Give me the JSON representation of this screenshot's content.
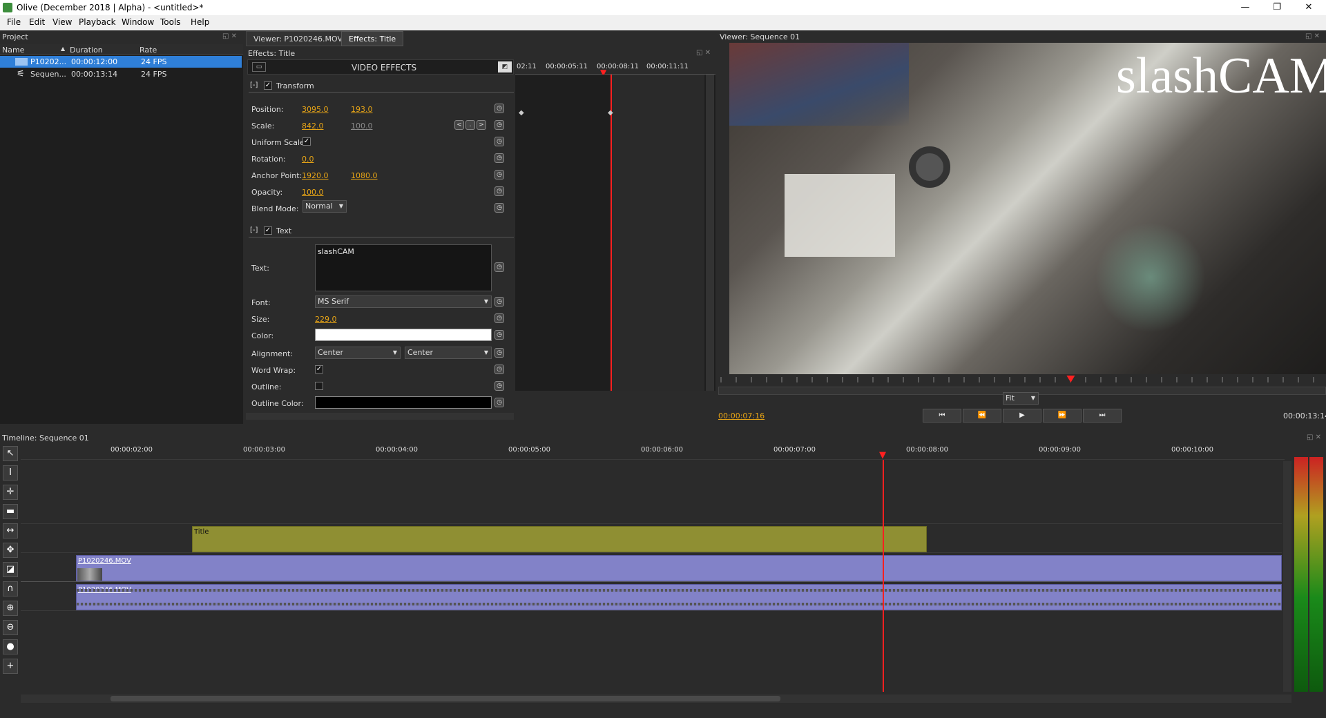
{
  "window": {
    "title": "Olive (December 2018 | Alpha) - <untitled>*",
    "minimize": "—",
    "maximize": "❐",
    "close": "✕"
  },
  "menu": [
    "File",
    "Edit",
    "View",
    "Playback",
    "Window",
    "Tools",
    "Help"
  ],
  "project": {
    "title": "Project",
    "columns": [
      "Name",
      "Duration",
      "Rate"
    ],
    "rows": [
      {
        "name": "P10202...",
        "duration": "00:00:12:00",
        "rate": "24 FPS"
      },
      {
        "name": "Sequen...",
        "duration": "00:00:13:14",
        "rate": "24 FPS"
      }
    ]
  },
  "center_tabs": [
    "Viewer: P1020246.MOV",
    "Effects: Title"
  ],
  "effects": {
    "title": "Effects: Title",
    "header": "VIDEO EFFECTS",
    "timecodes": [
      "02:11",
      "00:00:05:11",
      "00:00:08:11",
      "00:00:11:11"
    ],
    "transform": {
      "label": "Transform",
      "expander": "[-]",
      "position_label": "Position:",
      "position_x": "3095.0",
      "position_y": "193.0",
      "scale_label": "Scale:",
      "scale_x": "842.0",
      "scale_y": "100.0",
      "nav_prev": "<",
      "nav_mid": ".",
      "nav_next": ">",
      "uniform_label": "Uniform Scale:",
      "rotation_label": "Rotation:",
      "rotation": "0.0",
      "anchor_label": "Anchor Point:",
      "anchor_x": "1920.0",
      "anchor_y": "1080.0",
      "opacity_label": "Opacity:",
      "opacity": "100.0",
      "blend_label": "Blend Mode:",
      "blend": "Normal"
    },
    "text": {
      "label": "Text",
      "expander": "[-]",
      "text_label": "Text:",
      "text_value": "slashCAM",
      "font_label": "Font:",
      "font": "MS Serif",
      "size_label": "Size:",
      "size": "229.0",
      "color_label": "Color:",
      "color": "#ffffff",
      "alignment_label": "Alignment:",
      "align_h": "Center",
      "align_v": "Center",
      "wordwrap_label": "Word Wrap:",
      "outline_label": "Outline:",
      "outline_color_label": "Outline Color:",
      "outline_color": "#000000"
    }
  },
  "viewer": {
    "title": "Viewer: Sequence 01",
    "overlay_text": "slashCAM",
    "zoom": "Fit",
    "current_time": "00:00:07:16",
    "end_time": "00:00:13:14",
    "buttons": [
      "⏮",
      "⏪",
      "▶",
      "⏩",
      "⏭"
    ],
    "playhead": 0.58
  },
  "timeline": {
    "title": "Timeline: Sequence 01",
    "ruler": [
      "00:00:02:00",
      "00:00:03:00",
      "00:00:04:00",
      "00:00:05:00",
      "00:00:06:00",
      "00:00:07:00",
      "00:00:08:00",
      "00:00:09:00",
      "00:00:10:00"
    ],
    "clips": [
      {
        "name": "Title",
        "color": "#8f8f33"
      },
      {
        "name": "P1020246.MOV",
        "color": "#8282c8"
      },
      {
        "name": "P1020246.MOV",
        "color": "#8282c8"
      }
    ],
    "tools": [
      "↖",
      "I",
      "✛",
      "▬",
      "↔",
      "✥",
      "◪",
      "∩",
      "⊕",
      "⊖",
      "●",
      "+"
    ]
  },
  "colors": {
    "accent": "#e8a516",
    "playhead": "#ff2020",
    "selection": "#2f7fd8"
  }
}
